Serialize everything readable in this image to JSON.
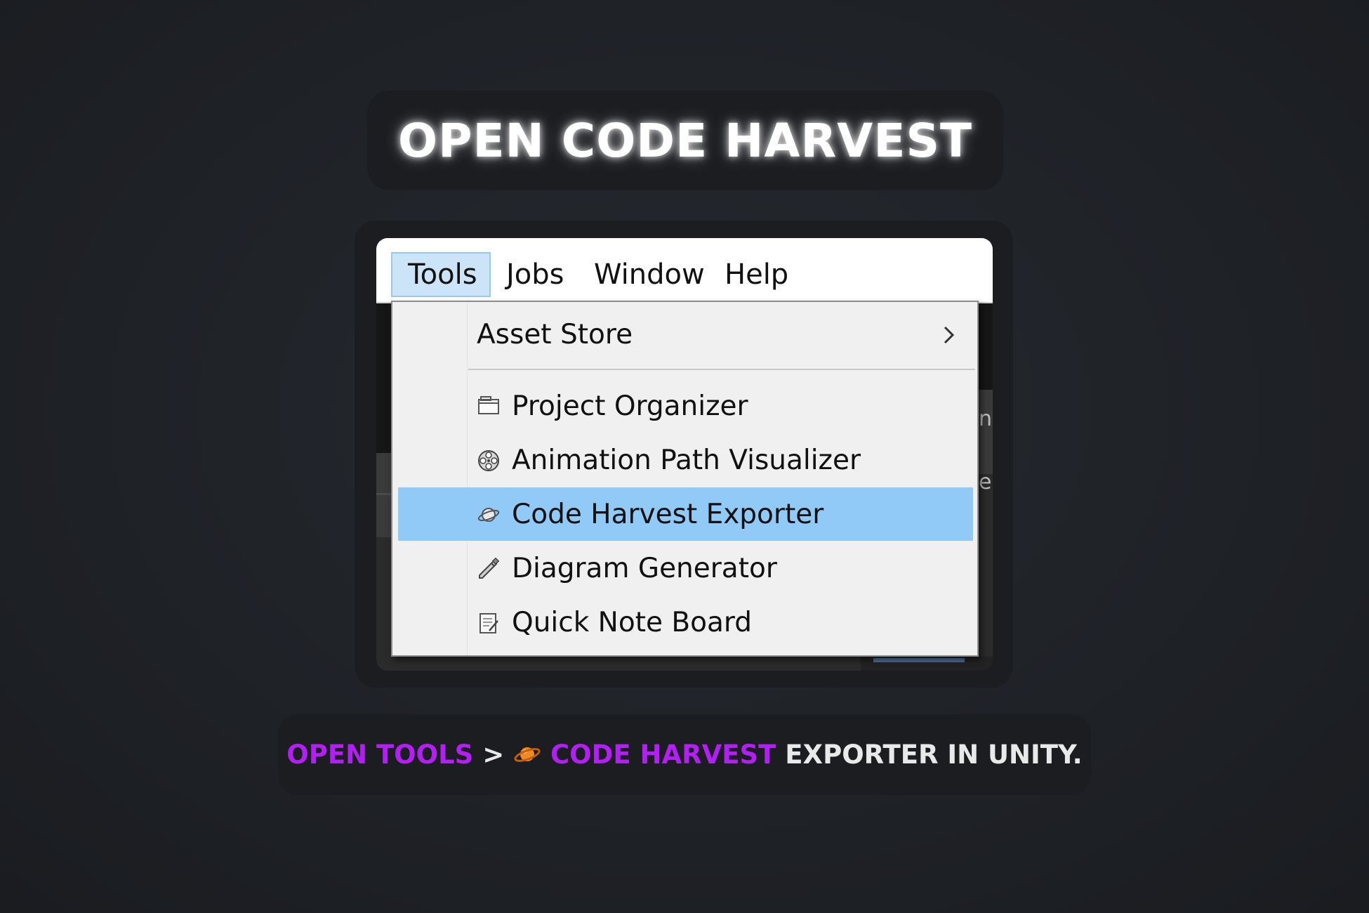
{
  "header": {
    "title": "OPEN CODE HARVEST"
  },
  "screenshot": {
    "menubar": {
      "items": [
        {
          "label": "Tools",
          "active": true
        },
        {
          "label": "Jobs",
          "active": false
        },
        {
          "label": "Window",
          "active": false
        },
        {
          "label": "Help",
          "active": false
        }
      ]
    },
    "dropdown": {
      "items": [
        {
          "label": "Asset Store",
          "icon": "none",
          "submenu": true,
          "highlighted": false
        },
        {
          "label": "Project Organizer",
          "icon": "window-icon",
          "highlighted": false
        },
        {
          "label": "Animation Path Visualizer",
          "icon": "film-reel-icon",
          "highlighted": false
        },
        {
          "label": "Code Harvest Exporter",
          "icon": "planet-icon",
          "highlighted": true
        },
        {
          "label": "Diagram Generator",
          "icon": "pencil-icon",
          "highlighted": false
        },
        {
          "label": "Quick Note Board",
          "icon": "notepad-icon",
          "highlighted": false
        }
      ],
      "highlight_color": "#91c9f7"
    }
  },
  "caption": {
    "part1": "OPEN TOOLS",
    "separator": ">",
    "part2": "CODE HARVEST",
    "part3": "EXPORTER IN UNITY.",
    "accent_color": "#b21ff2"
  }
}
